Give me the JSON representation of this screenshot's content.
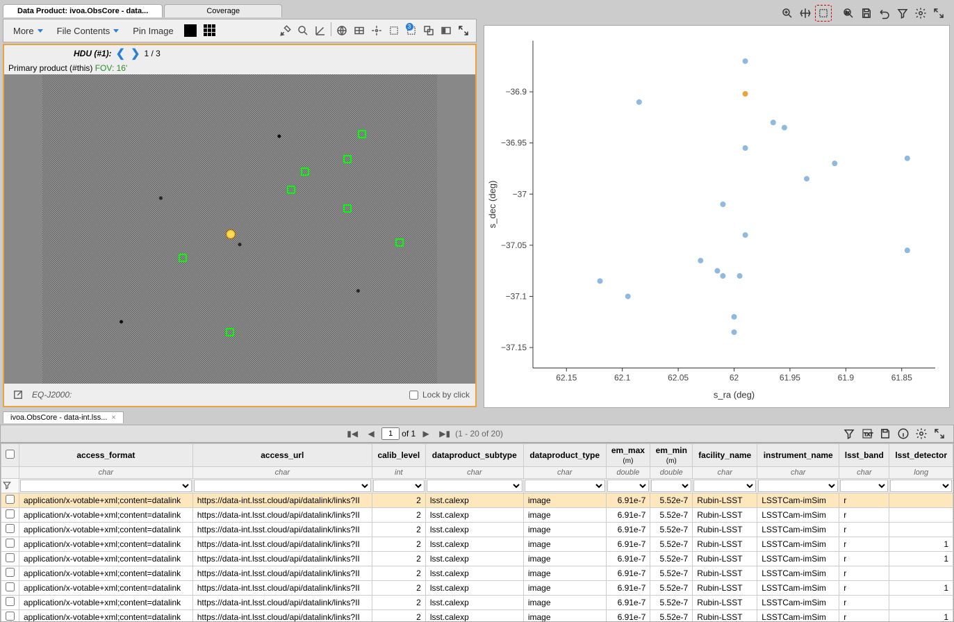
{
  "tabs": {
    "image_active": "Data Product: ivoa.ObsCore - data...",
    "image_inactive": "Coverage"
  },
  "left_toolbar": {
    "more": "More",
    "file_contents": "File Contents",
    "pin_image": "Pin Image"
  },
  "hdu": {
    "label": "HDU (#1):",
    "page": "1 / 3"
  },
  "product": {
    "label": "Primary product (#this)",
    "fov": "FOV: 16'"
  },
  "status": {
    "frame": "EQ-J2000:",
    "lock": "Lock by click"
  },
  "chart_data": {
    "type": "scatter",
    "xlabel": "s_ra (deg)",
    "ylabel": "s_dec (deg)",
    "xticks": [
      62.15,
      62.1,
      62.05,
      62,
      61.95,
      61.9,
      61.85
    ],
    "yticks": [
      -36.9,
      -36.95,
      -37,
      -37.05,
      -37.1,
      -37.15
    ],
    "xlim": [
      62.18,
      61.82
    ],
    "ylim": [
      -37.17,
      -36.85
    ],
    "series": [
      {
        "name": "points",
        "color": "#8fb9de",
        "values": [
          [
            62.12,
            -37.085
          ],
          [
            62.095,
            -37.1
          ],
          [
            62.085,
            -36.91
          ],
          [
            62.03,
            -37.065
          ],
          [
            62.015,
            -37.075
          ],
          [
            62.01,
            -37.08
          ],
          [
            62.01,
            -37.01
          ],
          [
            62.0,
            -37.12
          ],
          [
            61.995,
            -37.08
          ],
          [
            61.99,
            -37.04
          ],
          [
            61.99,
            -36.87
          ],
          [
            61.99,
            -36.955
          ],
          [
            62.0,
            -37.135
          ],
          [
            61.965,
            -36.93
          ],
          [
            61.955,
            -36.935
          ],
          [
            61.935,
            -36.985
          ],
          [
            61.91,
            -36.97
          ],
          [
            61.845,
            -37.055
          ],
          [
            61.845,
            -36.965
          ]
        ]
      },
      {
        "name": "selected",
        "color": "#e8a33d",
        "values": [
          [
            61.99,
            -36.902
          ]
        ]
      }
    ]
  },
  "table_tab": {
    "label": "ivoa.ObsCore - data-int.lss..."
  },
  "pager": {
    "page": "1",
    "of": "of 1",
    "range": "(1 - 20 of 20)"
  },
  "columns": [
    {
      "name": "access_format",
      "type": "char"
    },
    {
      "name": "access_url",
      "type": "char"
    },
    {
      "name": "calib_level",
      "type": "int"
    },
    {
      "name": "dataproduct_subtype",
      "type": "char"
    },
    {
      "name": "dataproduct_type",
      "type": "char"
    },
    {
      "name": "em_max",
      "unit": "(m)",
      "type": "double"
    },
    {
      "name": "em_min",
      "unit": "(m)",
      "type": "double"
    },
    {
      "name": "facility_name",
      "type": "char"
    },
    {
      "name": "instrument_name",
      "type": "char"
    },
    {
      "name": "lsst_band",
      "type": "char"
    },
    {
      "name": "lsst_detector",
      "type": "long"
    }
  ],
  "rows": [
    {
      "sel": true,
      "access_format": "application/x-votable+xml;content=datalink",
      "access_url": "https://data-int.lsst.cloud/api/datalink/links?II",
      "calib_level": 2,
      "subtype": "lsst.calexp",
      "ptype": "image",
      "em_max": "6.91e-7",
      "em_min": "5.52e-7",
      "facility": "Rubin-LSST",
      "instrument": "LSSTCam-imSim",
      "band": "r",
      "detector": ""
    },
    {
      "sel": false,
      "access_format": "application/x-votable+xml;content=datalink",
      "access_url": "https://data-int.lsst.cloud/api/datalink/links?II",
      "calib_level": 2,
      "subtype": "lsst.calexp",
      "ptype": "image",
      "em_max": "6.91e-7",
      "em_min": "5.52e-7",
      "facility": "Rubin-LSST",
      "instrument": "LSSTCam-imSim",
      "band": "r",
      "detector": ""
    },
    {
      "sel": false,
      "access_format": "application/x-votable+xml;content=datalink",
      "access_url": "https://data-int.lsst.cloud/api/datalink/links?II",
      "calib_level": 2,
      "subtype": "lsst.calexp",
      "ptype": "image",
      "em_max": "6.91e-7",
      "em_min": "5.52e-7",
      "facility": "Rubin-LSST",
      "instrument": "LSSTCam-imSim",
      "band": "r",
      "detector": ""
    },
    {
      "sel": false,
      "access_format": "application/x-votable+xml;content=datalink",
      "access_url": "https://data-int.lsst.cloud/api/datalink/links?II",
      "calib_level": 2,
      "subtype": "lsst.calexp",
      "ptype": "image",
      "em_max": "6.91e-7",
      "em_min": "5.52e-7",
      "facility": "Rubin-LSST",
      "instrument": "LSSTCam-imSim",
      "band": "r",
      "detector": "1"
    },
    {
      "sel": false,
      "access_format": "application/x-votable+xml;content=datalink",
      "access_url": "https://data-int.lsst.cloud/api/datalink/links?II",
      "calib_level": 2,
      "subtype": "lsst.calexp",
      "ptype": "image",
      "em_max": "6.91e-7",
      "em_min": "5.52e-7",
      "facility": "Rubin-LSST",
      "instrument": "LSSTCam-imSim",
      "band": "r",
      "detector": "1"
    },
    {
      "sel": false,
      "access_format": "application/x-votable+xml;content=datalink",
      "access_url": "https://data-int.lsst.cloud/api/datalink/links?II",
      "calib_level": 2,
      "subtype": "lsst.calexp",
      "ptype": "image",
      "em_max": "6.91e-7",
      "em_min": "5.52e-7",
      "facility": "Rubin-LSST",
      "instrument": "LSSTCam-imSim",
      "band": "r",
      "detector": ""
    },
    {
      "sel": false,
      "access_format": "application/x-votable+xml;content=datalink",
      "access_url": "https://data-int.lsst.cloud/api/datalink/links?II",
      "calib_level": 2,
      "subtype": "lsst.calexp",
      "ptype": "image",
      "em_max": "6.91e-7",
      "em_min": "5.52e-7",
      "facility": "Rubin-LSST",
      "instrument": "LSSTCam-imSim",
      "band": "r",
      "detector": "1"
    },
    {
      "sel": false,
      "access_format": "application/x-votable+xml;content=datalink",
      "access_url": "https://data-int.lsst.cloud/api/datalink/links?II",
      "calib_level": 2,
      "subtype": "lsst.calexp",
      "ptype": "image",
      "em_max": "6.91e-7",
      "em_min": "5.52e-7",
      "facility": "Rubin-LSST",
      "instrument": "LSSTCam-imSim",
      "band": "r",
      "detector": ""
    },
    {
      "sel": false,
      "access_format": "application/x-votable+xml;content=datalink",
      "access_url": "https://data-int.lsst.cloud/api/datalink/links?II",
      "calib_level": 2,
      "subtype": "lsst.calexp",
      "ptype": "image",
      "em_max": "6.91e-7",
      "em_min": "5.52e-7",
      "facility": "Rubin-LSST",
      "instrument": "LSSTCam-imSim",
      "band": "r",
      "detector": "1"
    }
  ]
}
